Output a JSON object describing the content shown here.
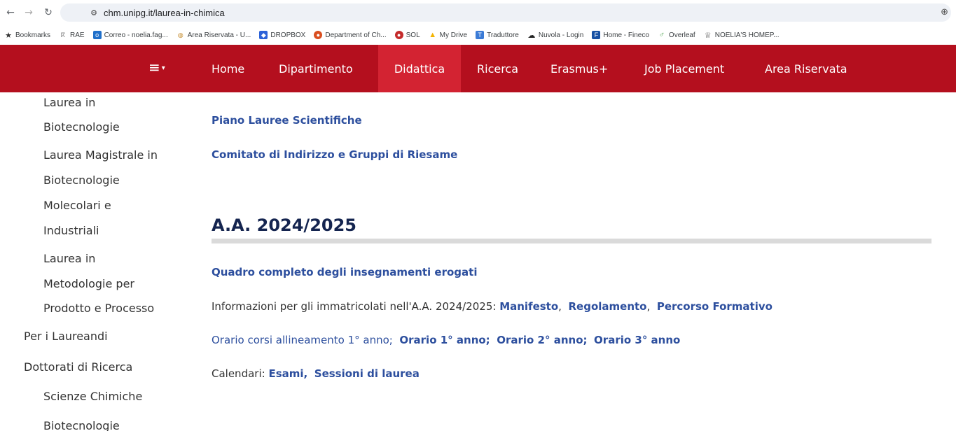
{
  "browser": {
    "url": "chm.unipg.it/laurea-in-chimica",
    "bookmarks": [
      {
        "label": "Bookmarks",
        "icon": "star-icon",
        "color": "#333333"
      },
      {
        "label": "RAE",
        "icon": "rae-icon",
        "color": "#888888"
      },
      {
        "label": "Correo - noelia.fag...",
        "icon": "outlook-icon",
        "color": "#1f6fc9"
      },
      {
        "label": "Area Riservata - U...",
        "icon": "unipg-icon",
        "color": "#c48a2a"
      },
      {
        "label": "DROPBOX",
        "icon": "dropbox-icon",
        "color": "#2c62d8"
      },
      {
        "label": "Department of Ch...",
        "icon": "department-icon",
        "color": "#d94e1f"
      },
      {
        "label": "SOL",
        "icon": "sol-icon",
        "color": "#c42b2b"
      },
      {
        "label": "My Drive",
        "icon": "drive-icon",
        "color": "#f4b400"
      },
      {
        "label": "Traduttore",
        "icon": "translate-icon",
        "color": "#3b7bd6"
      },
      {
        "label": "Nuvola - Login",
        "icon": "cloud-icon",
        "color": "#222222"
      },
      {
        "label": "Home - Fineco",
        "icon": "fineco-icon",
        "color": "#1650a3"
      },
      {
        "label": "Overleaf",
        "icon": "overleaf-icon",
        "color": "#3f9b3f"
      },
      {
        "label": "NOELIA'S HOMEP...",
        "icon": "homepage-icon",
        "color": "#555555"
      }
    ]
  },
  "nav": {
    "menu_glyph": "≡",
    "items": [
      "Home",
      "Dipartimento",
      "Didattica",
      "Ricerca",
      "Erasmus+",
      "Job Placement",
      "Area Riservata"
    ],
    "active": "Didattica",
    "bg_color": "#b40f1e",
    "active_color": "#d32332"
  },
  "sidebar": {
    "items": [
      "Laurea in",
      "Biotecnologie",
      "Laurea Magistrale in",
      "Biotecnologie",
      "Molecolari e",
      "Industriali",
      "Laurea in",
      "Metodologie per",
      "Prodotto e Processo",
      "Per i Laureandi",
      "Dottorati di Ricerca",
      "Scienze Chimiche",
      "Biotecnologie"
    ]
  },
  "content": {
    "link_pls": "Piano Lauree Scientifiche",
    "link_comitato": "Comitato di Indirizzo e Gruppi di Riesame",
    "heading": "A.A. 2024/2025",
    "link_quadro": "Quadro completo degli insegnamenti erogati",
    "info_prefix": "Informazioni per gli immatricolati nell'A.A. 2024/2025: ",
    "link_manifesto": "Manifesto",
    "link_regolamento": "Regolamento",
    "link_percorso": "Percorso Formativo",
    "link_orario_allineamento": "Orario corsi allineamento 1° anno;",
    "link_orario1": "Orario 1° anno;",
    "link_orario2": "Orario 2° anno;",
    "link_orario3": "Orario 3° anno",
    "calendari_prefix": "Calendari: ",
    "link_esami": "Esami,",
    "link_sessioni": "Sessioni di laurea",
    "sep": ",",
    "link_color": "#2d4f9e",
    "heading_color": "#14244f"
  }
}
